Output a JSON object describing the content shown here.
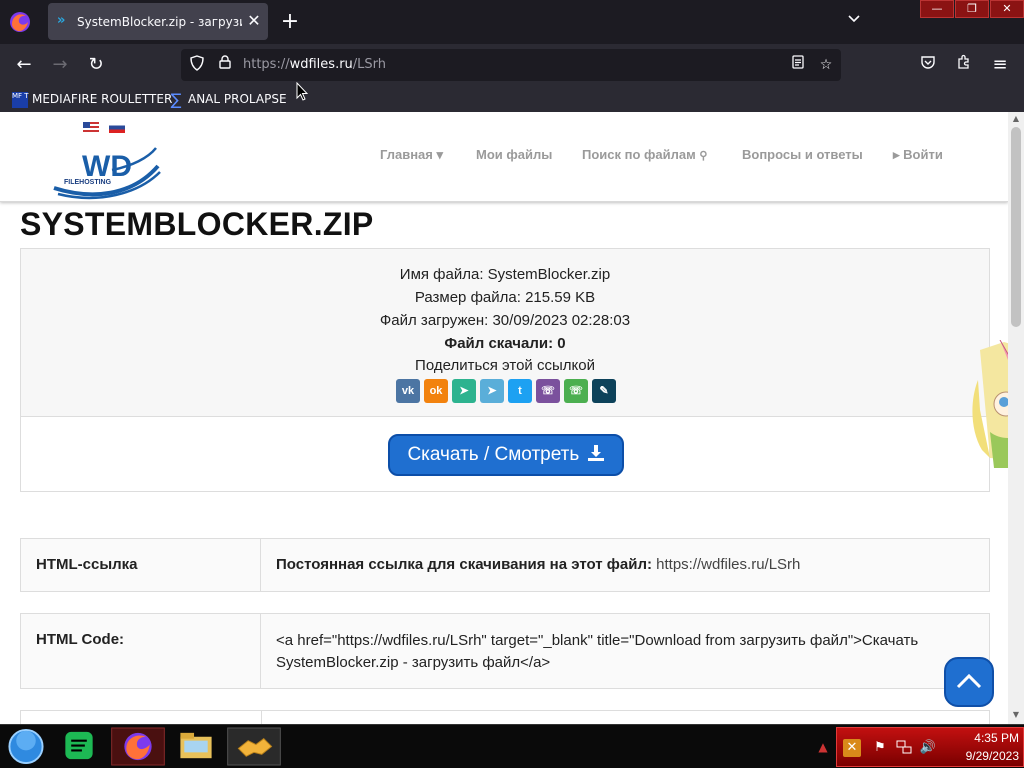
{
  "browser": {
    "tab": {
      "title": "SystemBlocker.zip - загрузить файл",
      "close_glyph": "✕"
    },
    "new_tab_glyph": "+",
    "tab_list_glyph": "⌄",
    "window_controls": {
      "minimize": "—",
      "restore": "❐",
      "close": "✕"
    },
    "nav": {
      "back": "←",
      "forward": "→",
      "reload": "↻"
    },
    "url": {
      "scheme": "https://",
      "host": "wdfiles.ru",
      "path": "/LSrh"
    },
    "bookmarks": [
      {
        "label": "MEDIAFIRE ROULETTER",
        "icon_text": "MF T"
      },
      {
        "label": "ANAL PROLAPSE"
      }
    ]
  },
  "site": {
    "logo_text": "WD",
    "logo_sub": "FILEHOSTING",
    "nav": [
      {
        "label": "Главная ▾"
      },
      {
        "label": "Мои файлы"
      },
      {
        "label": "Поиск по файлам"
      },
      {
        "label": "Вопросы и ответы"
      },
      {
        "label": "▸ Войти"
      }
    ],
    "page_title": "SYSTEMBLOCKER.ZIP",
    "file_info": {
      "name_label": "Имя файла:",
      "name_value": "SystemBlocker.zip",
      "size_label": "Размер файла:",
      "size_value": "215.59 KB",
      "uploaded_label": "Файл загружен:",
      "uploaded_value": "30/09/2023 02:28:03",
      "downloads_label": "Файл скачали:",
      "downloads_value": "0",
      "share_label": "Поделиться этой ссылкой"
    },
    "share_buttons": [
      {
        "name": "vk",
        "glyph": "vk",
        "color": "#4c75a3"
      },
      {
        "name": "odnoklassniki",
        "glyph": "ok",
        "color": "#f2820e"
      },
      {
        "name": "moimir",
        "glyph": "➤",
        "color": "#2db38f"
      },
      {
        "name": "telegram",
        "glyph": "➤",
        "color": "#5aaed9"
      },
      {
        "name": "twitter",
        "glyph": "t",
        "color": "#1da1f2"
      },
      {
        "name": "viber",
        "glyph": "☏",
        "color": "#7b519d"
      },
      {
        "name": "whatsapp",
        "glyph": "☏",
        "color": "#4caf50"
      },
      {
        "name": "livejournal",
        "glyph": "✎",
        "color": "#0d425a"
      }
    ],
    "download_button": "Скачать / Смотреть",
    "html_link": {
      "label": "HTML-ссылка",
      "prefix": "Постоянная ссылка для скачивания на этот файл:",
      "url": "https://wdfiles.ru/LSrh"
    },
    "html_code": {
      "label": "HTML Code:",
      "value": "<a href=\"https://wdfiles.ru/LSrh\" target=\"_blank\" title=\"Download from загрузить файл\">Скачать SystemBlocker.zip - загрузить файл</a>"
    }
  },
  "taskbar": {
    "time": "4:35 PM",
    "date": "9/29/2023"
  },
  "colors": {
    "accent": "#1f6fd0",
    "browser_dark": "#1c1b22",
    "taskbar_tray": "#c21010"
  }
}
